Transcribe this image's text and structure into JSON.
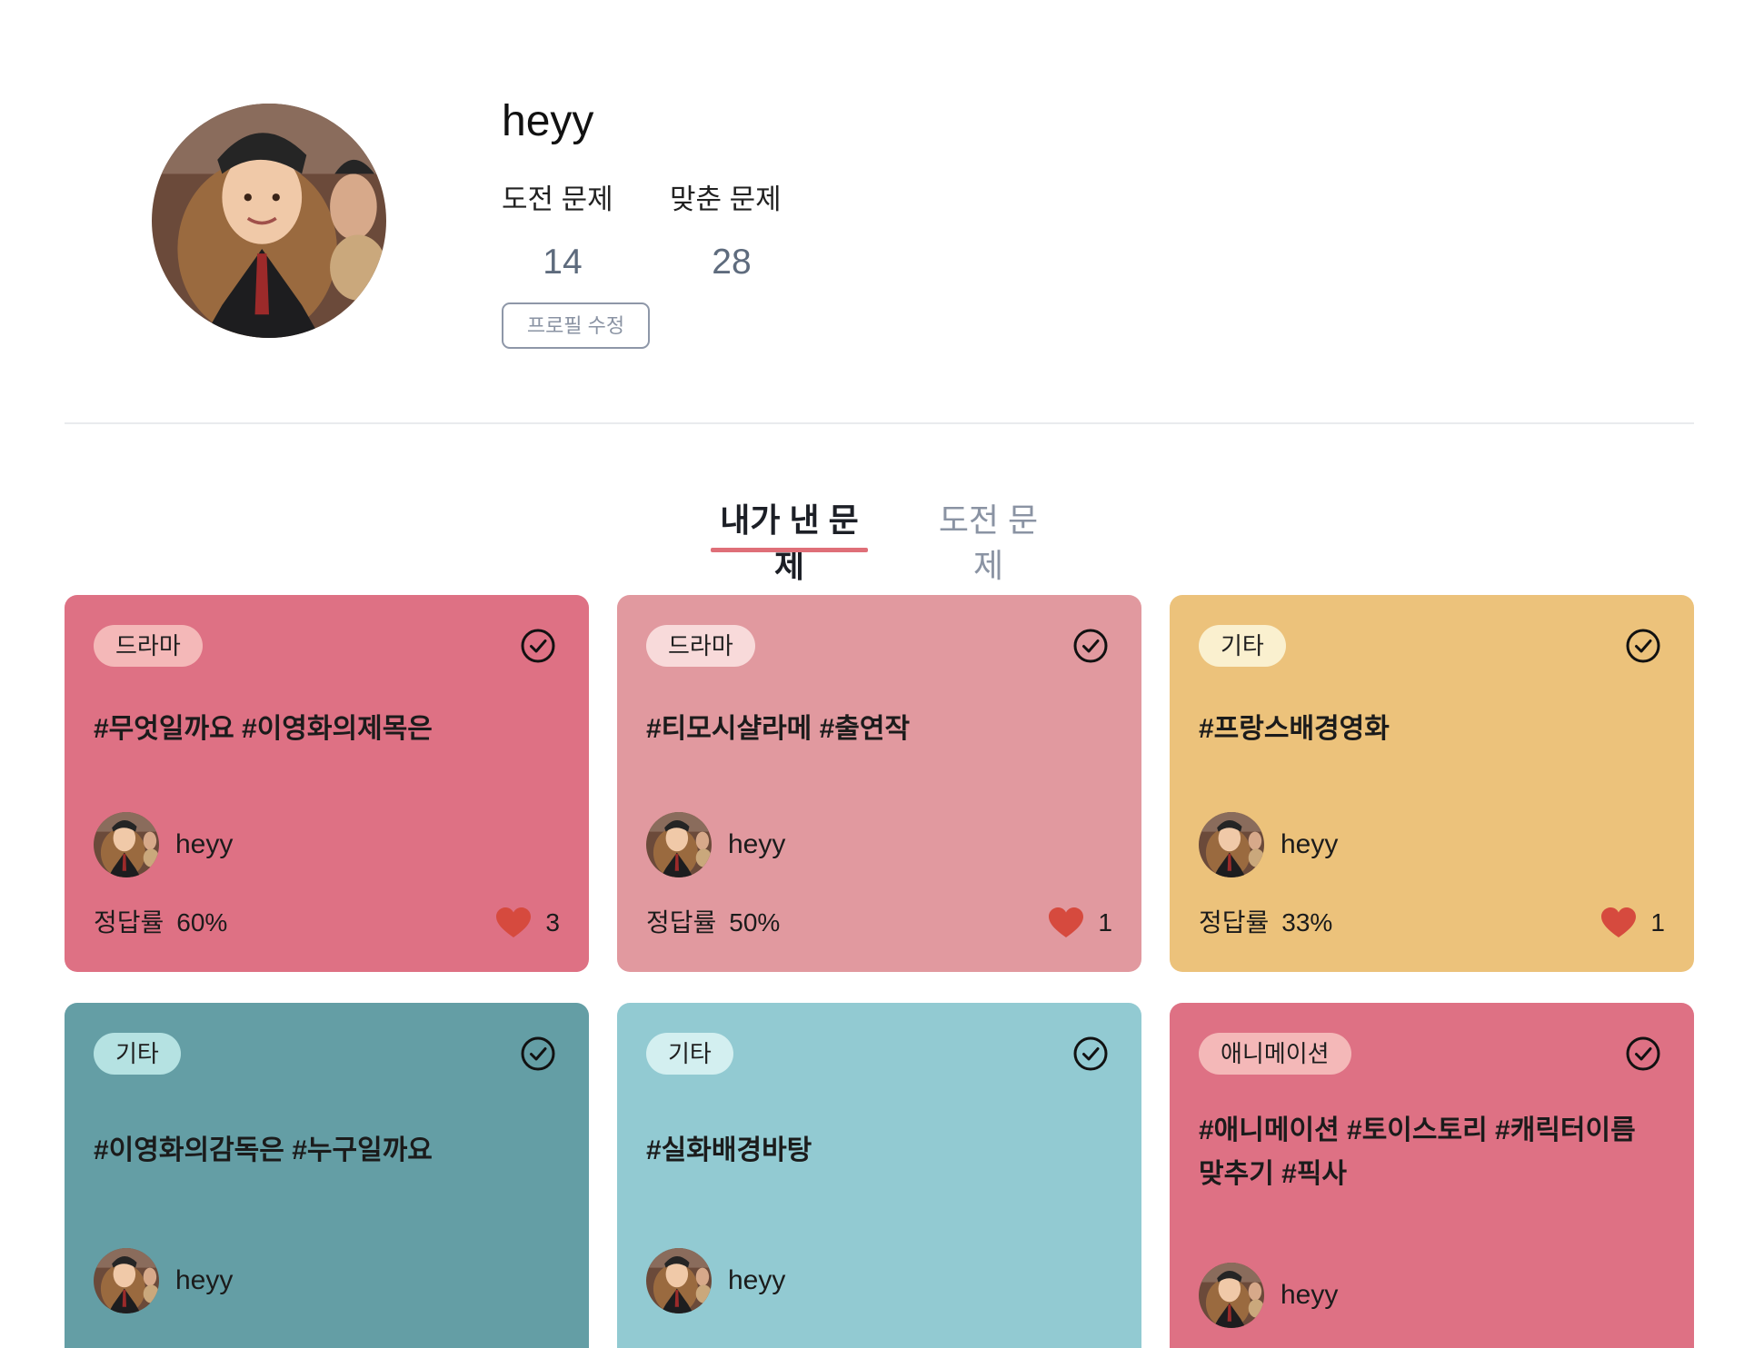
{
  "profile": {
    "username": "heyy",
    "stats": [
      {
        "label": "도전 문제",
        "value": "14"
      },
      {
        "label": "맞춘 문제",
        "value": "28"
      }
    ],
    "edit_button": "프로필 수정"
  },
  "tabs": [
    {
      "label": "내가 낸 문제",
      "active": true
    },
    {
      "label": "도전 문제",
      "active": false
    }
  ],
  "card_labels": {
    "rate_label": "정답률"
  },
  "cards": [
    {
      "category": "드라마",
      "title": "#무엇일까요 #이영화의제목은",
      "author": "heyy",
      "rate": "60%",
      "likes": "3",
      "bg": "#de7184",
      "tag_bg": "#f4b8b8"
    },
    {
      "category": "드라마",
      "title": "#티모시샬라메 #출연작",
      "author": "heyy",
      "rate": "50%",
      "likes": "1",
      "bg": "#e1999f",
      "tag_bg": "#f8dada"
    },
    {
      "category": "기타",
      "title": "#프랑스배경영화",
      "author": "heyy",
      "rate": "33%",
      "likes": "1",
      "bg": "#ecc27b",
      "tag_bg": "#faf0cf"
    },
    {
      "category": "기타",
      "title": "#이영화의감독은 #누구일까요",
      "author": "heyy",
      "bg": "#649ea5",
      "tag_bg": "#b5e2e2"
    },
    {
      "category": "기타",
      "title": "#실화배경바탕",
      "author": "heyy",
      "bg": "#92cad2",
      "tag_bg": "#d3eff0"
    },
    {
      "category": "애니메이션",
      "title": "#애니메이션 #토이스토리 #캐릭터이름 맞추기 #픽사",
      "author": "heyy",
      "bg": "#de7184",
      "tag_bg": "#f4b8b8"
    }
  ],
  "colors": {
    "tab_underline": "#df6f78",
    "heart": "#d64a3e",
    "stat_value": "#5e6b7d",
    "divider": "#e9ebee"
  }
}
